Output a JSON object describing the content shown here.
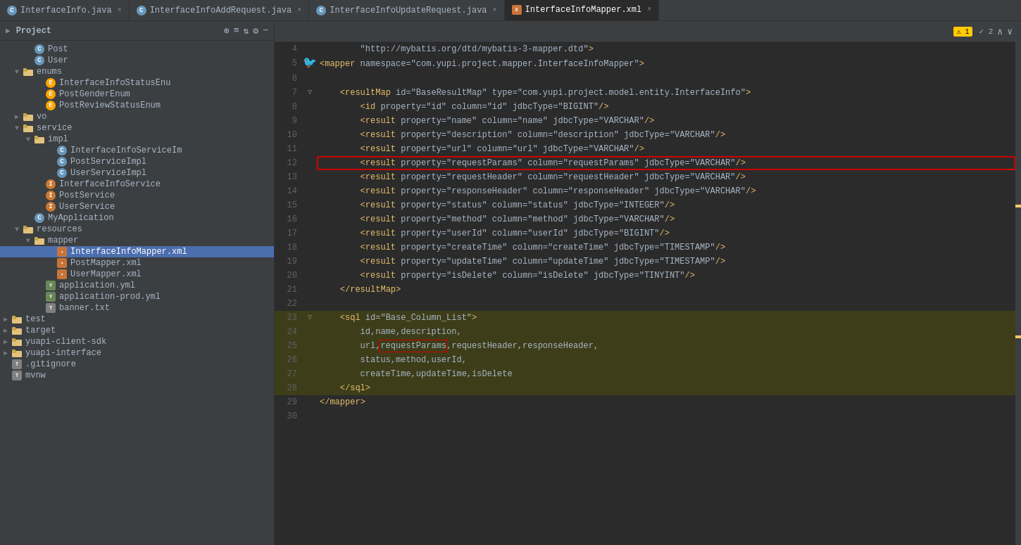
{
  "tabs": [
    {
      "id": "interfaceinfo-java",
      "label": "InterfaceInfo.java",
      "type": "c",
      "active": false
    },
    {
      "id": "interfaceinfo-add",
      "label": "InterfaceInfoAddRequest.java",
      "type": "c",
      "active": false
    },
    {
      "id": "interfaceinfo-update",
      "label": "InterfaceInfoUpdateRequest.java",
      "type": "c",
      "active": false
    },
    {
      "id": "interfaceinfo-mapper",
      "label": "InterfaceInfoMapper.xml",
      "type": "xml",
      "active": true
    }
  ],
  "sidebar": {
    "title": "Project",
    "icons": [
      "⊕",
      "≡",
      "⇅",
      "⚙",
      "−"
    ]
  },
  "tree": [
    {
      "id": "post",
      "label": "Post",
      "indent": 2,
      "type": "c",
      "arrow": "empty"
    },
    {
      "id": "user",
      "label": "User",
      "indent": 2,
      "type": "c",
      "arrow": "empty"
    },
    {
      "id": "enums",
      "label": "enums",
      "indent": 1,
      "type": "folder",
      "arrow": "expanded"
    },
    {
      "id": "interfaceinfostatus",
      "label": "InterfaceInfoStatusEnu",
      "indent": 3,
      "type": "e",
      "arrow": "empty"
    },
    {
      "id": "postgenderenum",
      "label": "PostGenderEnum",
      "indent": 3,
      "type": "e",
      "arrow": "empty"
    },
    {
      "id": "postreviewstatus",
      "label": "PostReviewStatusEnum",
      "indent": 3,
      "type": "e",
      "arrow": "empty"
    },
    {
      "id": "vo",
      "label": "vo",
      "indent": 1,
      "type": "folder",
      "arrow": "collapsed"
    },
    {
      "id": "service",
      "label": "service",
      "indent": 1,
      "type": "folder",
      "arrow": "expanded"
    },
    {
      "id": "impl",
      "label": "impl",
      "indent": 2,
      "type": "folder",
      "arrow": "expanded"
    },
    {
      "id": "interfaceinfoserviceimpl",
      "label": "InterfaceInfoServiceIm",
      "indent": 4,
      "type": "c",
      "arrow": "empty"
    },
    {
      "id": "postserviceimpl",
      "label": "PostServiceImpl",
      "indent": 4,
      "type": "c",
      "arrow": "empty"
    },
    {
      "id": "userserviceimpl",
      "label": "UserServiceImpl",
      "indent": 4,
      "type": "c",
      "arrow": "empty"
    },
    {
      "id": "interfaceinfoservice",
      "label": "InterfaceInfoService",
      "indent": 3,
      "type": "i",
      "arrow": "empty"
    },
    {
      "id": "postservice",
      "label": "PostService",
      "indent": 3,
      "type": "i",
      "arrow": "empty"
    },
    {
      "id": "userservice",
      "label": "UserService",
      "indent": 3,
      "type": "i",
      "arrow": "empty"
    },
    {
      "id": "myapplication",
      "label": "MyApplication",
      "indent": 2,
      "type": "c",
      "arrow": "empty"
    },
    {
      "id": "resources",
      "label": "resources",
      "indent": 1,
      "type": "folder",
      "arrow": "expanded"
    },
    {
      "id": "mapper",
      "label": "mapper",
      "indent": 2,
      "type": "folder",
      "arrow": "expanded"
    },
    {
      "id": "interfaceinfomapper-xml",
      "label": "InterfaceInfoMapper.xml",
      "indent": 4,
      "type": "mybatis",
      "arrow": "empty",
      "selected": true
    },
    {
      "id": "postmapper-xml",
      "label": "PostMapper.xml",
      "indent": 4,
      "type": "mybatis",
      "arrow": "empty"
    },
    {
      "id": "usermapper-xml",
      "label": "UserMapper.xml",
      "indent": 4,
      "type": "mybatis",
      "arrow": "empty"
    },
    {
      "id": "application-yml",
      "label": "application.yml",
      "indent": 3,
      "type": "yml",
      "arrow": "empty"
    },
    {
      "id": "application-prod-yml",
      "label": "application-prod.yml",
      "indent": 3,
      "type": "yml",
      "arrow": "empty"
    },
    {
      "id": "banner-txt",
      "label": "banner.txt",
      "indent": 3,
      "type": "txt",
      "arrow": "empty"
    },
    {
      "id": "test",
      "label": "test",
      "indent": 0,
      "type": "folder",
      "arrow": "collapsed"
    },
    {
      "id": "target",
      "label": "target",
      "indent": 0,
      "type": "folder",
      "arrow": "collapsed"
    },
    {
      "id": "yuapi-client-sdk",
      "label": "yuapi-client-sdk",
      "indent": 0,
      "type": "folder",
      "arrow": "collapsed"
    },
    {
      "id": "yuapi-interface",
      "label": "yuapi-interface",
      "indent": 0,
      "type": "folder",
      "arrow": "collapsed"
    },
    {
      "id": "gitignore",
      "label": ".gitignore",
      "indent": 0,
      "type": "txt",
      "arrow": "empty"
    },
    {
      "id": "mvnw",
      "label": "mvnw",
      "indent": 0,
      "type": "txt",
      "arrow": "empty"
    }
  ],
  "lines": [
    {
      "num": 4,
      "content": "        \"http://mybatis.org/dtd/mybatis-3-mapper.dtd\">"
    },
    {
      "num": 5,
      "content": "<mapper namespace=\"com.yupi.project.mapper.InterfaceInfoMapper\">"
    },
    {
      "num": 6,
      "content": ""
    },
    {
      "num": 7,
      "content": "    <resultMap id=\"BaseResultMap\" type=\"com.yupi.project.model.entity.InterfaceInfo\">"
    },
    {
      "num": 8,
      "content": "        <id property=\"id\" column=\"id\" jdbcType=\"BIGINT\"/>"
    },
    {
      "num": 9,
      "content": "        <result property=\"name\" column=\"name\" jdbcType=\"VARCHAR\"/>"
    },
    {
      "num": 10,
      "content": "        <result property=\"description\" column=\"description\" jdbcType=\"VARCHAR\"/>"
    },
    {
      "num": 11,
      "content": "        <result property=\"url\" column=\"url\" jdbcType=\"VARCHAR\"/>"
    },
    {
      "num": 12,
      "content": "        <result property=\"requestParams\" column=\"requestParams\" jdbcType=\"VARCHAR\"/>",
      "redBorder": true
    },
    {
      "num": 13,
      "content": "        <result property=\"requestHeader\" column=\"requestHeader\" jdbcType=\"VARCHAR\"/>"
    },
    {
      "num": 14,
      "content": "        <result property=\"responseHeader\" column=\"responseHeader\" jdbcType=\"VARCHAR\"/>"
    },
    {
      "num": 15,
      "content": "        <result property=\"status\" column=\"status\" jdbcType=\"INTEGER\"/>"
    },
    {
      "num": 16,
      "content": "        <result property=\"method\" column=\"method\" jdbcType=\"VARCHAR\"/>"
    },
    {
      "num": 17,
      "content": "        <result property=\"userId\" column=\"userId\" jdbcType=\"BIGINT\"/>"
    },
    {
      "num": 18,
      "content": "        <result property=\"createTime\" column=\"createTime\" jdbcType=\"TIMESTAMP\"/>"
    },
    {
      "num": 19,
      "content": "        <result property=\"updateTime\" column=\"updateTime\" jdbcType=\"TIMESTAMP\"/>"
    },
    {
      "num": 20,
      "content": "        <result property=\"isDelete\" column=\"isDelete\" jdbcType=\"TINYINT\"/>"
    },
    {
      "num": 21,
      "content": "    </resultMap>"
    },
    {
      "num": 22,
      "content": ""
    },
    {
      "num": 23,
      "content": "    <sql id=\"Base_Column_List\">",
      "sqlStart": true
    },
    {
      "num": 24,
      "content": "        id,name,description,",
      "sqlContent": true
    },
    {
      "num": 25,
      "content": "        url,requestParams,requestHeader,responseHeader,",
      "sqlContent": true
    },
    {
      "num": 26,
      "content": "        status,method,userId,",
      "sqlContent": true
    },
    {
      "num": 27,
      "content": "        createTime,updateTime,isDelete",
      "sqlContent": true
    },
    {
      "num": 28,
      "content": "    </sql>",
      "sqlEnd": true
    },
    {
      "num": 29,
      "content": "</mapper>"
    },
    {
      "num": 30,
      "content": ""
    }
  ]
}
